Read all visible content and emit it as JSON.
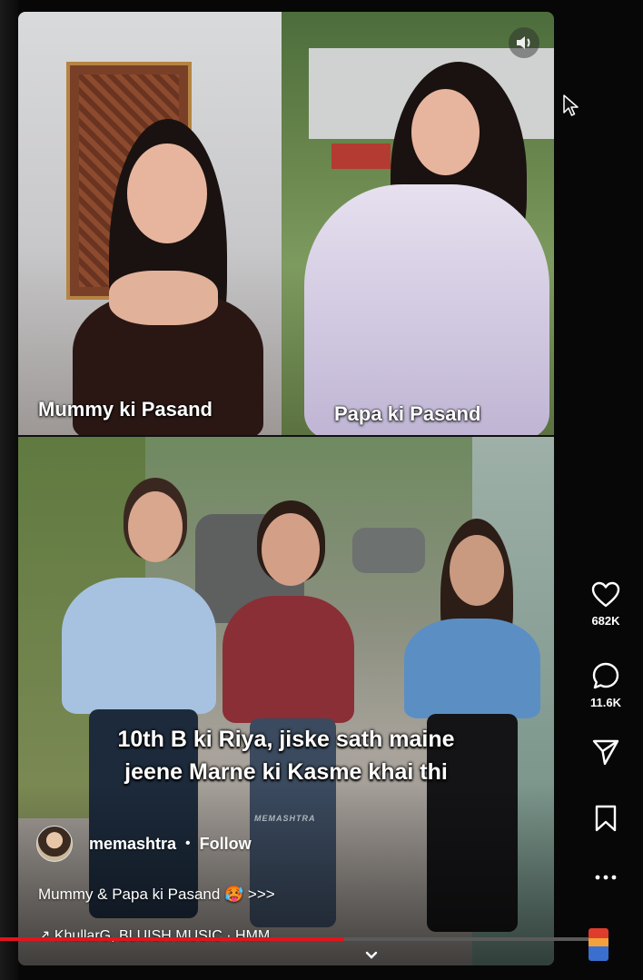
{
  "video": {
    "top_left_caption": "Mummy ki Pasand",
    "top_right_caption": "Papa ki Pasand",
    "subtitle_line1": "10th B ki Riya, jiske sath maine",
    "subtitle_line2": "jeene Marne ki Kasme khai thi",
    "watermark": "MEMASHTRA"
  },
  "post": {
    "username": "memashtra",
    "separator": "•",
    "follow_label": "Follow",
    "caption": "Mummy & Papa ki Pasand 🥵 >>>",
    "audio": "↗ KhullarG, BLUISH MUSIC · HMM"
  },
  "actions": {
    "likes": "682K",
    "comments": "11.6K"
  },
  "player": {
    "progress": 0.585
  },
  "icons": {
    "mute": "speaker-icon",
    "like": "heart-icon",
    "comment": "comment-icon",
    "share": "share-icon",
    "save": "bookmark-icon",
    "more": "more-icon",
    "scroll": "chevron-down-icon"
  },
  "colors": {
    "progress": "#e3141b",
    "background": "#070707"
  }
}
